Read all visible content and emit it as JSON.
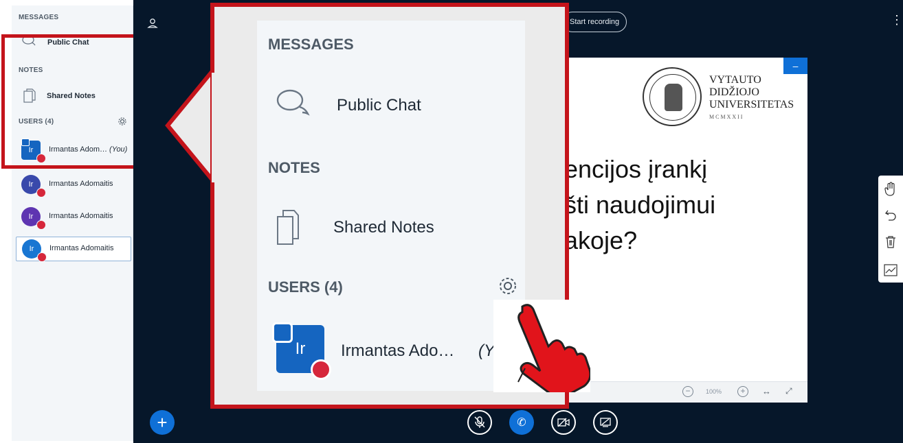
{
  "sidebar": {
    "messages_header": "MESSAGES",
    "public_chat": "Public Chat",
    "notes_header": "NOTES",
    "shared_notes": "Shared Notes",
    "users_header": "USERS (4)",
    "users": [
      {
        "initials": "Ir",
        "name": "Irmantas Adom…",
        "you": "(You)",
        "color": "#1565c0",
        "shape": "square",
        "presenter": true
      },
      {
        "initials": "Ir",
        "name": "Irmantas Adomaitis",
        "you": "",
        "color": "#3949ab",
        "shape": "round",
        "presenter": false
      },
      {
        "initials": "Ir",
        "name": "Irmantas Adomaitis",
        "you": "",
        "color": "#5e35b1",
        "shape": "round",
        "presenter": false
      },
      {
        "initials": "Ir",
        "name": "Irmantas Adomaitis",
        "you": "",
        "color": "#1976d2",
        "shape": "round",
        "presenter": false
      }
    ]
  },
  "header": {
    "recording_label": "Start recording"
  },
  "slide": {
    "logo_line1": "VYTAUTO",
    "logo_line2": "DIDŽIOJO",
    "logo_line3": "UNIVERSITETAS",
    "logo_line4": "M C M X X I I",
    "text_line1": "encijos įrankį",
    "text_line2": "šti naudojimui",
    "text_line3": "akoje?",
    "zoom_level": "100%"
  },
  "callout": {
    "messages_header": "MESSAGES",
    "public_chat": "Public Chat",
    "notes_header": "NOTES",
    "shared_notes": "Shared Notes",
    "users_header": "USERS (4)",
    "user_initials": "Ir",
    "user_name": "Irmantas Ado…",
    "user_you": "(Yo"
  },
  "colors": {
    "main_bg": "#06172a",
    "accent_blue": "#0f70d7",
    "highlight_red": "#c4141b",
    "muted_red": "#d6273b"
  }
}
